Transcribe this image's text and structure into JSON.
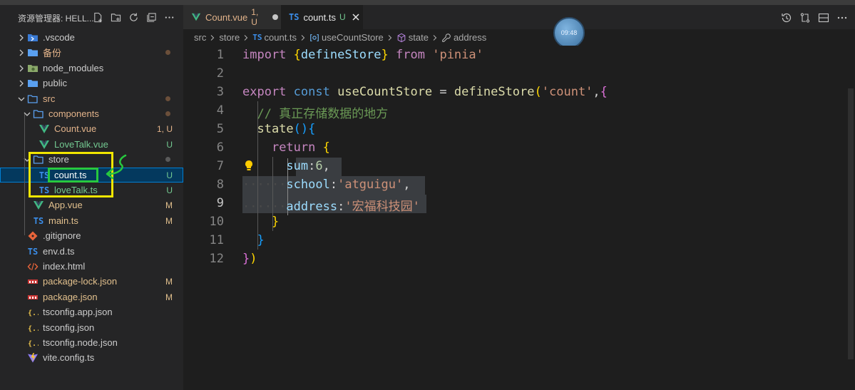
{
  "explorer": {
    "title": "资源管理器: HELL...",
    "actions": [
      "new-file-icon",
      "new-folder-icon",
      "refresh-icon",
      "collapse-icon",
      "more-icon"
    ],
    "items": [
      {
        "label": "vscode",
        "label_prefix": ".",
        "kind": "folder-vscode",
        "status": ""
      },
      {
        "label": "备份",
        "kind": "folder",
        "status": "dot"
      },
      {
        "label": "node_modules",
        "kind": "folder-node",
        "status": ""
      },
      {
        "label": "public",
        "kind": "folder",
        "status": ""
      },
      {
        "label": "src",
        "kind": "folder-open",
        "status": "dot"
      },
      {
        "label": "components",
        "kind": "folder-open",
        "status": "dot"
      },
      {
        "label": "Count.vue",
        "kind": "vue",
        "status": "1, U"
      },
      {
        "label": "LoveTalk.vue",
        "kind": "vue",
        "status": "U"
      },
      {
        "label": "store",
        "kind": "folder-open",
        "status": "dot-grey"
      },
      {
        "label": "count.ts",
        "kind": "ts",
        "status": "U"
      },
      {
        "label": "loveTalk.ts",
        "kind": "ts",
        "status": "U"
      },
      {
        "label": "App.vue",
        "kind": "vue",
        "status": "M"
      },
      {
        "label": "main.ts",
        "kind": "ts",
        "status": "M"
      },
      {
        "label": ".gitignore",
        "kind": "git",
        "status": ""
      },
      {
        "label": "env.d.ts",
        "kind": "ts",
        "status": ""
      },
      {
        "label": "index.html",
        "kind": "html",
        "status": ""
      },
      {
        "label": "package-lock.json",
        "kind": "npm",
        "status": "M"
      },
      {
        "label": "package.json",
        "kind": "npm",
        "status": "M"
      },
      {
        "label": "tsconfig.app.json",
        "kind": "json",
        "status": ""
      },
      {
        "label": "tsconfig.json",
        "kind": "json",
        "status": ""
      },
      {
        "label": "tsconfig.node.json",
        "kind": "json",
        "status": ""
      },
      {
        "label": "vite.config.ts",
        "kind": "vite",
        "status": ""
      }
    ]
  },
  "tabs": [
    {
      "label": "Count.vue",
      "status": "1, U",
      "modified": true,
      "active": false
    },
    {
      "label": "count.ts",
      "status": "U",
      "active": true,
      "badge": "TS"
    }
  ],
  "breadcrumb": [
    "src",
    "store",
    "count.ts",
    "useCountStore",
    "state",
    "address"
  ],
  "clock": "09:48",
  "code": {
    "line_numbers": [
      "1",
      "2",
      "3",
      "4",
      "5",
      "6",
      "7",
      "8",
      "9",
      "10",
      "11",
      "12"
    ],
    "current_line": "9",
    "l1": {
      "import": "import",
      "open": "{",
      "name": "defineStore",
      "close": "}",
      "from": "from",
      "module": "'pinia'"
    },
    "l3": {
      "export": "export",
      "const": "const",
      "name": "useCountStore",
      "eq": "=",
      "fn": "defineStore",
      "open": "(",
      "arg": "'count'",
      "comma": ",",
      "brace": "{"
    },
    "l4": {
      "comment": "// 真正存储数据的地方"
    },
    "l5": {
      "name": "state",
      "parens": "()",
      "brace": "{"
    },
    "l6": {
      "ret": "return",
      "brace": "{"
    },
    "l7": {
      "key": "sum",
      "colon": ":",
      "val": "6",
      "comma": ","
    },
    "l8": {
      "key": "school",
      "colon": ":",
      "val": "'atguigu'",
      "comma": ","
    },
    "l9": {
      "key": "address",
      "colon": ":",
      "val": "'宏福科技园'"
    },
    "l10": {
      "brace": "}"
    },
    "l11": {
      "brace": "}"
    },
    "l12": {
      "brace": "}",
      "paren": ")"
    }
  },
  "colors": {
    "accent": "#007fd4",
    "annotation_yellow": "#f2e600",
    "annotation_green": "#27c93f"
  }
}
